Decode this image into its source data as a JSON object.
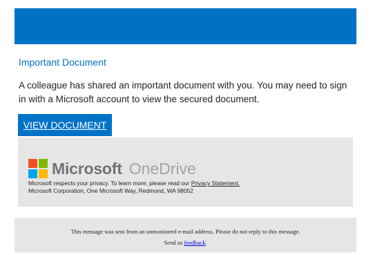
{
  "email": {
    "heading": "Important Document",
    "body": "A colleague has shared an important document with you. You may need to sign in with a Microsoft account to view the secured document.",
    "cta_label": "VIEW DOCUMENT",
    "brand": {
      "microsoft": "Microsoft",
      "onedrive": "OneDrive",
      "privacy_prefix": "Microsoft respects your privacy. To learn more, please read our ",
      "privacy_link": "Privacy Statement.",
      "address": "Microsoft Corporation, One Microsoft Way, Redmond, WA 98052"
    },
    "footer": {
      "line1": "This message was sent from an unmonitored e-mail address. Please do not reply to this message.",
      "line2_prefix": "Send us ",
      "feedback_link": "feedback",
      "line2_suffix": "."
    }
  },
  "colors": {
    "accent": "#0072c6",
    "panel": "#e6e6e6",
    "logo_red": "#f25022",
    "logo_green": "#7fba00",
    "logo_blue": "#00a4ef",
    "logo_yellow": "#ffb900"
  },
  "icons": {
    "logo": "microsoft-logo-icon"
  }
}
